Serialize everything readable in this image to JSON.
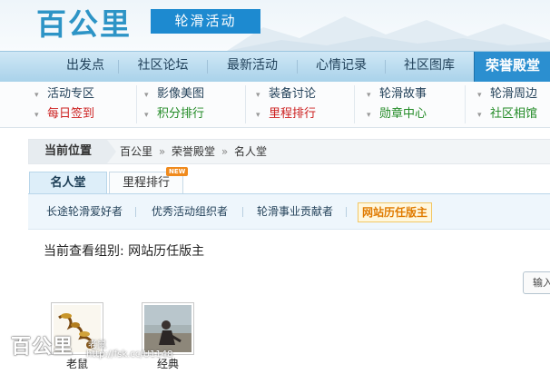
{
  "header": {
    "logo": "百公里",
    "section_tag": "轮滑活动"
  },
  "mainnav": {
    "items": [
      "出发点",
      "社区论坛",
      "最新活动",
      "心情记录",
      "社区图库",
      "荣誉殿堂"
    ],
    "active_index": 5
  },
  "subnav": {
    "col1": [
      {
        "label": "活动专区"
      },
      {
        "label": "每日签到"
      }
    ],
    "col2": [
      {
        "label": "影像美图"
      },
      {
        "label": "积分排行"
      }
    ],
    "col3": [
      {
        "label": "装备讨论"
      },
      {
        "label": "里程排行"
      }
    ],
    "col4": [
      {
        "label": "轮滑故事"
      },
      {
        "label": "勋章中心"
      }
    ],
    "col5": [
      {
        "label": "轮滑周边"
      },
      {
        "label": "社区相馆"
      }
    ]
  },
  "breadcrumb": {
    "label": "当前位置",
    "trail": [
      "百公里",
      "荣誉殿堂",
      "名人堂"
    ],
    "separator": "»"
  },
  "tabs": [
    {
      "label": "名人堂",
      "active": true
    },
    {
      "label": "里程排行",
      "active": false,
      "badge": "NEW"
    }
  ],
  "groups": [
    {
      "label": "长途轮滑爱好者",
      "active": false
    },
    {
      "label": "优秀活动组织者",
      "active": false
    },
    {
      "label": "轮滑事业贡献者",
      "active": false
    },
    {
      "label": "网站历任版主",
      "active": true
    }
  ],
  "current_group_text": "当前查看组别: 网站历任版主",
  "search_button": "输入",
  "members": [
    {
      "name": "老鼠"
    },
    {
      "name": "经典"
    }
  ],
  "watermark": {
    "site": "百公里",
    "small": "老鼠",
    "url": "http://fsk.cc/U1148"
  },
  "colors": {
    "accent": "#2d94c6",
    "nav_active": "#2b8fd0",
    "sub_red": "#cc1f1f",
    "sub_green": "#218a25",
    "group_active": "#e07b00"
  }
}
